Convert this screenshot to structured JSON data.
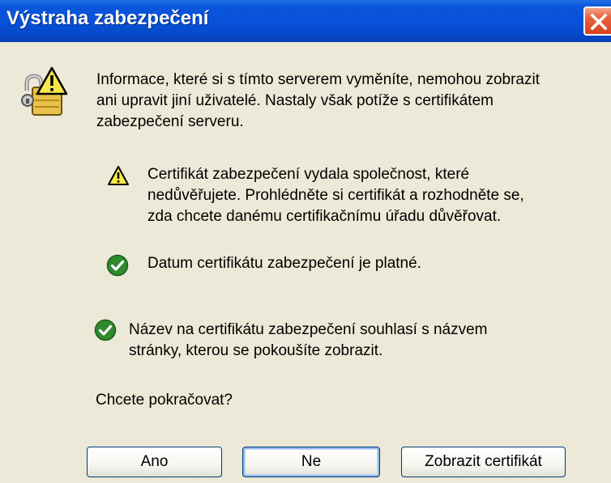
{
  "dialog": {
    "title": "Výstraha zabezpečení",
    "intro_line1": "Informace, které si s tímto serverem vyměníte, nemohou zobrazit",
    "intro_line2": "ani upravit jiní uživatelé. Nastaly však potíže s certifikátem",
    "intro_line3": "zabezpečení serveru.",
    "items": [
      {
        "status": "warning",
        "icon": "warning-icon",
        "lines": [
          "Certifikát zabezpečení vydala společnost, které",
          "nedůvěřujete. Prohlédněte si certifikát a rozhodněte se,",
          "zda chcete danému certifikačnímu úřadu důvěřovat."
        ]
      },
      {
        "status": "ok",
        "icon": "check-icon",
        "lines": [
          "Datum certifikátu zabezpečení je platné."
        ]
      },
      {
        "status": "ok",
        "icon": "check-icon",
        "lines": [
          "Název na certifikátu zabezpečení souhlasí s názvem",
          "stránky, kterou se pokoušíte zobrazit."
        ]
      }
    ],
    "question": "Chcete pokračovat?",
    "buttons": {
      "yes": "Ano",
      "no": "Ne",
      "view_certificate": "Zobrazit certifikát"
    }
  },
  "colors": {
    "titlebar": "#0651d9",
    "dialog_background": "#ece9d8",
    "close_button": "#d9421e",
    "warning": "#f7e84a",
    "ok": "#2d8a2d"
  }
}
